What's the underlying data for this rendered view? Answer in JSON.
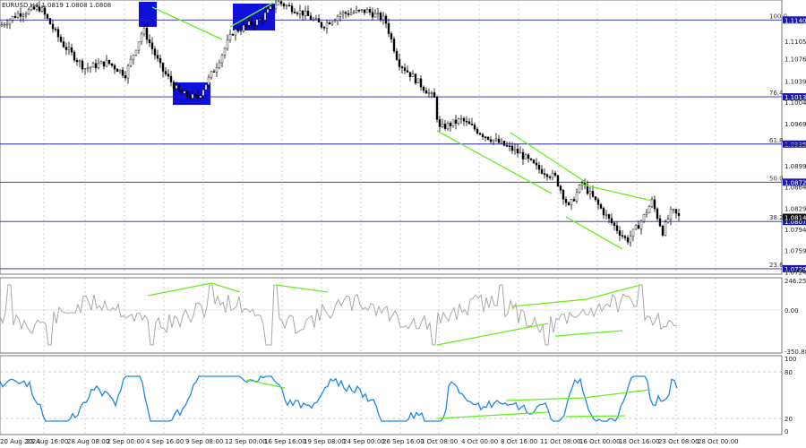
{
  "chart": {
    "symbol": "EURUSD,H4",
    "ohlc_text": "1.0819 1.0808 1.0808",
    "fib_levels": [
      {
        "pct": "100.0",
        "price": "1.1140"
      },
      {
        "pct": "76.4",
        "price": "1.1013"
      },
      {
        "pct": "61.8",
        "price": "1.0935"
      },
      {
        "pct": "50.0",
        "price": "1.0872"
      },
      {
        "pct": "38.2",
        "price": "1.0807"
      },
      {
        "pct": "23.6",
        "price": "1.0729"
      }
    ],
    "price_ticks": [
      "1.1105",
      "1.1076",
      "1.1039",
      "1.1004",
      "1.0969",
      "1.0934",
      "1.0899",
      "1.0864",
      "1.0829",
      "1.0794",
      "1.0759",
      "1.0724"
    ],
    "current_price": "1.0814",
    "time_labels": [
      "20 Aug 2024",
      "23 Aug 16:00",
      "28 Aug 08:00",
      "2 Sep 00:00",
      "4 Sep 16:00",
      "9 Sep 08:00",
      "12 Sep 00:00",
      "16 Sep 16:00",
      "19 Sep 08:00",
      "24 Sep 00:00",
      "26 Sep 16:00",
      "1 Oct 08:00",
      "4 Oct 00:00",
      "8 Oct 16:00",
      "11 Oct 08:00",
      "16 Oct 00:00",
      "18 Oct 16:00",
      "23 Oct 08:00",
      "28 Oct 00:00"
    ]
  },
  "cci": {
    "top": "246.2588",
    "zero": "0.00",
    "bottom": "-350.886"
  },
  "rsi": {
    "top": "100",
    "upper": "80",
    "lower": "20",
    "bottom": "0"
  },
  "colors": {
    "grid": "#b0b4c8",
    "level": "#2222aa",
    "candle": "#000000",
    "trend": "#66ee22",
    "box": "#1010dd",
    "cci": "#a8a8a8",
    "rsi": "#1e88e5",
    "label_bg": "#1a1aaa"
  }
}
